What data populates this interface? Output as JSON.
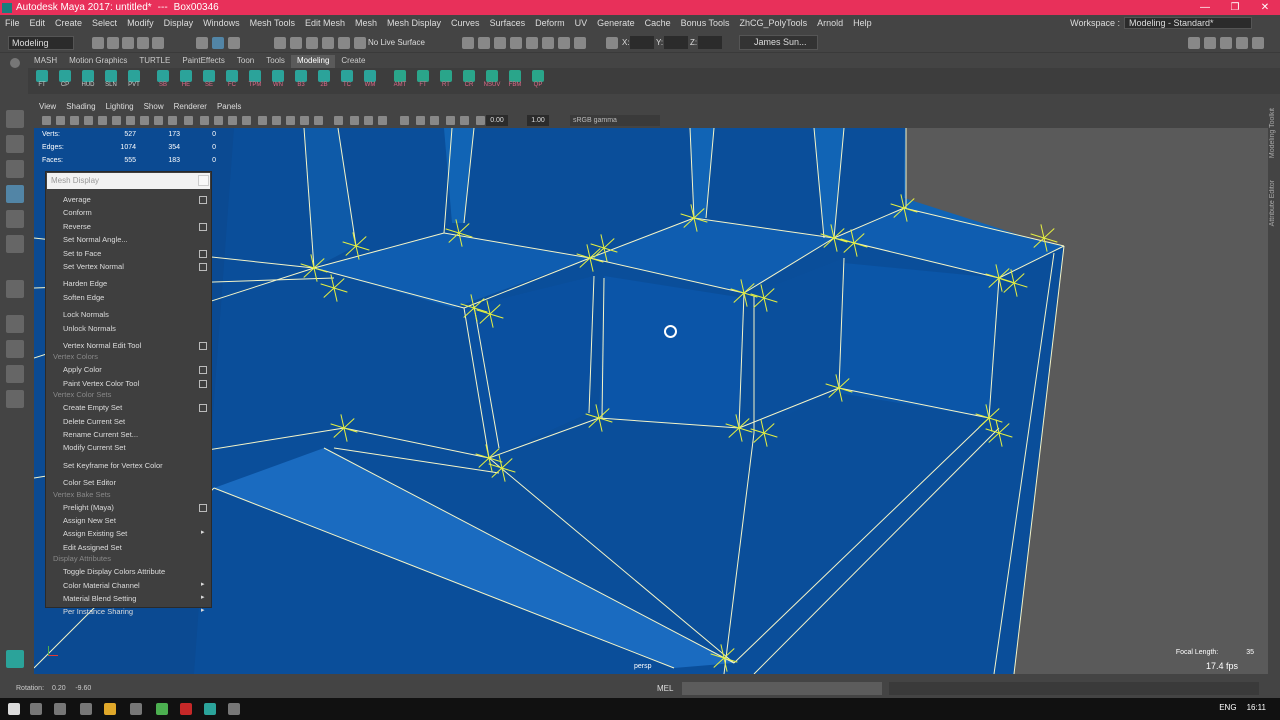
{
  "title": {
    "app": "Autodesk Maya 2017: untitled*",
    "separator": "---",
    "object": "Box00346",
    "minimize": "—",
    "maximize": "❐",
    "close": "✕"
  },
  "menubar": [
    "File",
    "Edit",
    "Create",
    "Select",
    "Modify",
    "Display",
    "Windows",
    "Mesh Tools",
    "Edit Mesh",
    "Mesh",
    "Mesh Display",
    "Curves",
    "Surfaces",
    "Deform",
    "UV",
    "Generate",
    "Cache",
    "Bonus Tools",
    "ZhCG_PolyTools",
    "Arnold",
    "Help"
  ],
  "workspace": {
    "label": "Workspace :",
    "value": "Modeling - Standard*"
  },
  "statusline": {
    "mode": "Modeling",
    "no_live": "No Live Surface",
    "user": "James Sun...",
    "x_label": "X:",
    "y_label": "Y:",
    "z_label": "Z:"
  },
  "shelf_tabs": [
    "MASH",
    "Motion Graphics",
    "TURTLE",
    "PaintEffects",
    "Toon",
    "Tools",
    "Modeling",
    "Create"
  ],
  "shelf_active": "Modeling",
  "shelf_buttons": [
    "FT",
    "CP",
    "HUD",
    "SLN",
    "PVT",
    "SB",
    "HE",
    "SE",
    "FC",
    "TPM",
    "WN",
    "B3",
    "2B",
    "TC",
    "WM",
    "AMT",
    "FT",
    "RT",
    "CR",
    "NSUV",
    "FBM",
    "QP"
  ],
  "panel_menu": [
    "View",
    "Shading",
    "Lighting",
    "Show",
    "Renderer",
    "Panels"
  ],
  "panel_toolbar": {
    "val1": "0.00",
    "val2": "1.00",
    "gamma": "sRGB gamma"
  },
  "hud": {
    "rows": [
      [
        "Verts:",
        "527",
        "173",
        "0"
      ],
      [
        "Edges:",
        "1074",
        "354",
        "0"
      ],
      [
        "Faces:",
        "555",
        "183",
        "0"
      ]
    ],
    "focal_label": "Focal Length:",
    "focal_value": "35",
    "fps": "17.4 fps",
    "camera": "persp"
  },
  "popup": {
    "title": "Mesh Display",
    "items": [
      {
        "type": "item",
        "label": "Average",
        "box": true
      },
      {
        "type": "item",
        "label": "Conform",
        "box": false
      },
      {
        "type": "item",
        "label": "Reverse",
        "box": true
      },
      {
        "type": "item",
        "label": "Set Normal Angle...",
        "box": false
      },
      {
        "type": "item",
        "label": "Set to Face",
        "box": true
      },
      {
        "type": "item",
        "label": "Set Vertex Normal",
        "box": true
      },
      {
        "type": "item",
        "label": "Harden Edge",
        "box": false
      },
      {
        "type": "item",
        "label": "Soften Edge",
        "box": false
      },
      {
        "type": "item",
        "label": "Lock Normals",
        "box": false
      },
      {
        "type": "item",
        "label": "Unlock Normals",
        "box": false
      },
      {
        "type": "item",
        "label": "Vertex Normal Edit Tool",
        "box": true
      },
      {
        "type": "hdr",
        "label": "Vertex Colors"
      },
      {
        "type": "item",
        "label": "Apply Color",
        "box": true
      },
      {
        "type": "item",
        "label": "Paint Vertex Color Tool",
        "box": true
      },
      {
        "type": "hdr",
        "label": "Vertex Color Sets"
      },
      {
        "type": "item",
        "label": "Create Empty Set",
        "box": true
      },
      {
        "type": "item",
        "label": "Delete Current Set",
        "box": false
      },
      {
        "type": "item",
        "label": "Rename Current Set...",
        "box": false
      },
      {
        "type": "item",
        "label": "Modify Current Set",
        "box": false
      },
      {
        "type": "item",
        "label": "Set Keyframe for Vertex Color",
        "box": false
      },
      {
        "type": "item",
        "label": "Color Set Editor",
        "box": false
      },
      {
        "type": "hdr",
        "label": "Vertex Bake Sets"
      },
      {
        "type": "item",
        "label": "Prelight (Maya)",
        "box": true
      },
      {
        "type": "item",
        "label": "Assign New Set",
        "box": false
      },
      {
        "type": "item",
        "label": "Assign Existing Set",
        "arrow": true
      },
      {
        "type": "item",
        "label": "Edit Assigned Set",
        "box": false
      },
      {
        "type": "hdr",
        "label": "Display Attributes"
      },
      {
        "type": "item",
        "label": "Toggle Display Colors Attribute",
        "box": false
      },
      {
        "type": "item",
        "label": "Color Material Channel",
        "arrow": true
      },
      {
        "type": "item",
        "label": "Material Blend Setting",
        "arrow": true
      },
      {
        "type": "item",
        "label": "Per Instance Sharing",
        "arrow": true
      }
    ]
  },
  "right_strip": [
    "Modeling Toolkit",
    "Attribute Editor"
  ],
  "cmdline": {
    "rotation_label": "Rotation:",
    "rotation_values": "0.20     -9.60",
    "mel": "MEL"
  },
  "taskbar": {
    "lang": "ENG",
    "time": "16:11"
  },
  "colors": {
    "mesh": "#0a4e9a",
    "wire": "#f5f5c8",
    "normal": "#e6f041",
    "titlebar": "#e8305a"
  }
}
